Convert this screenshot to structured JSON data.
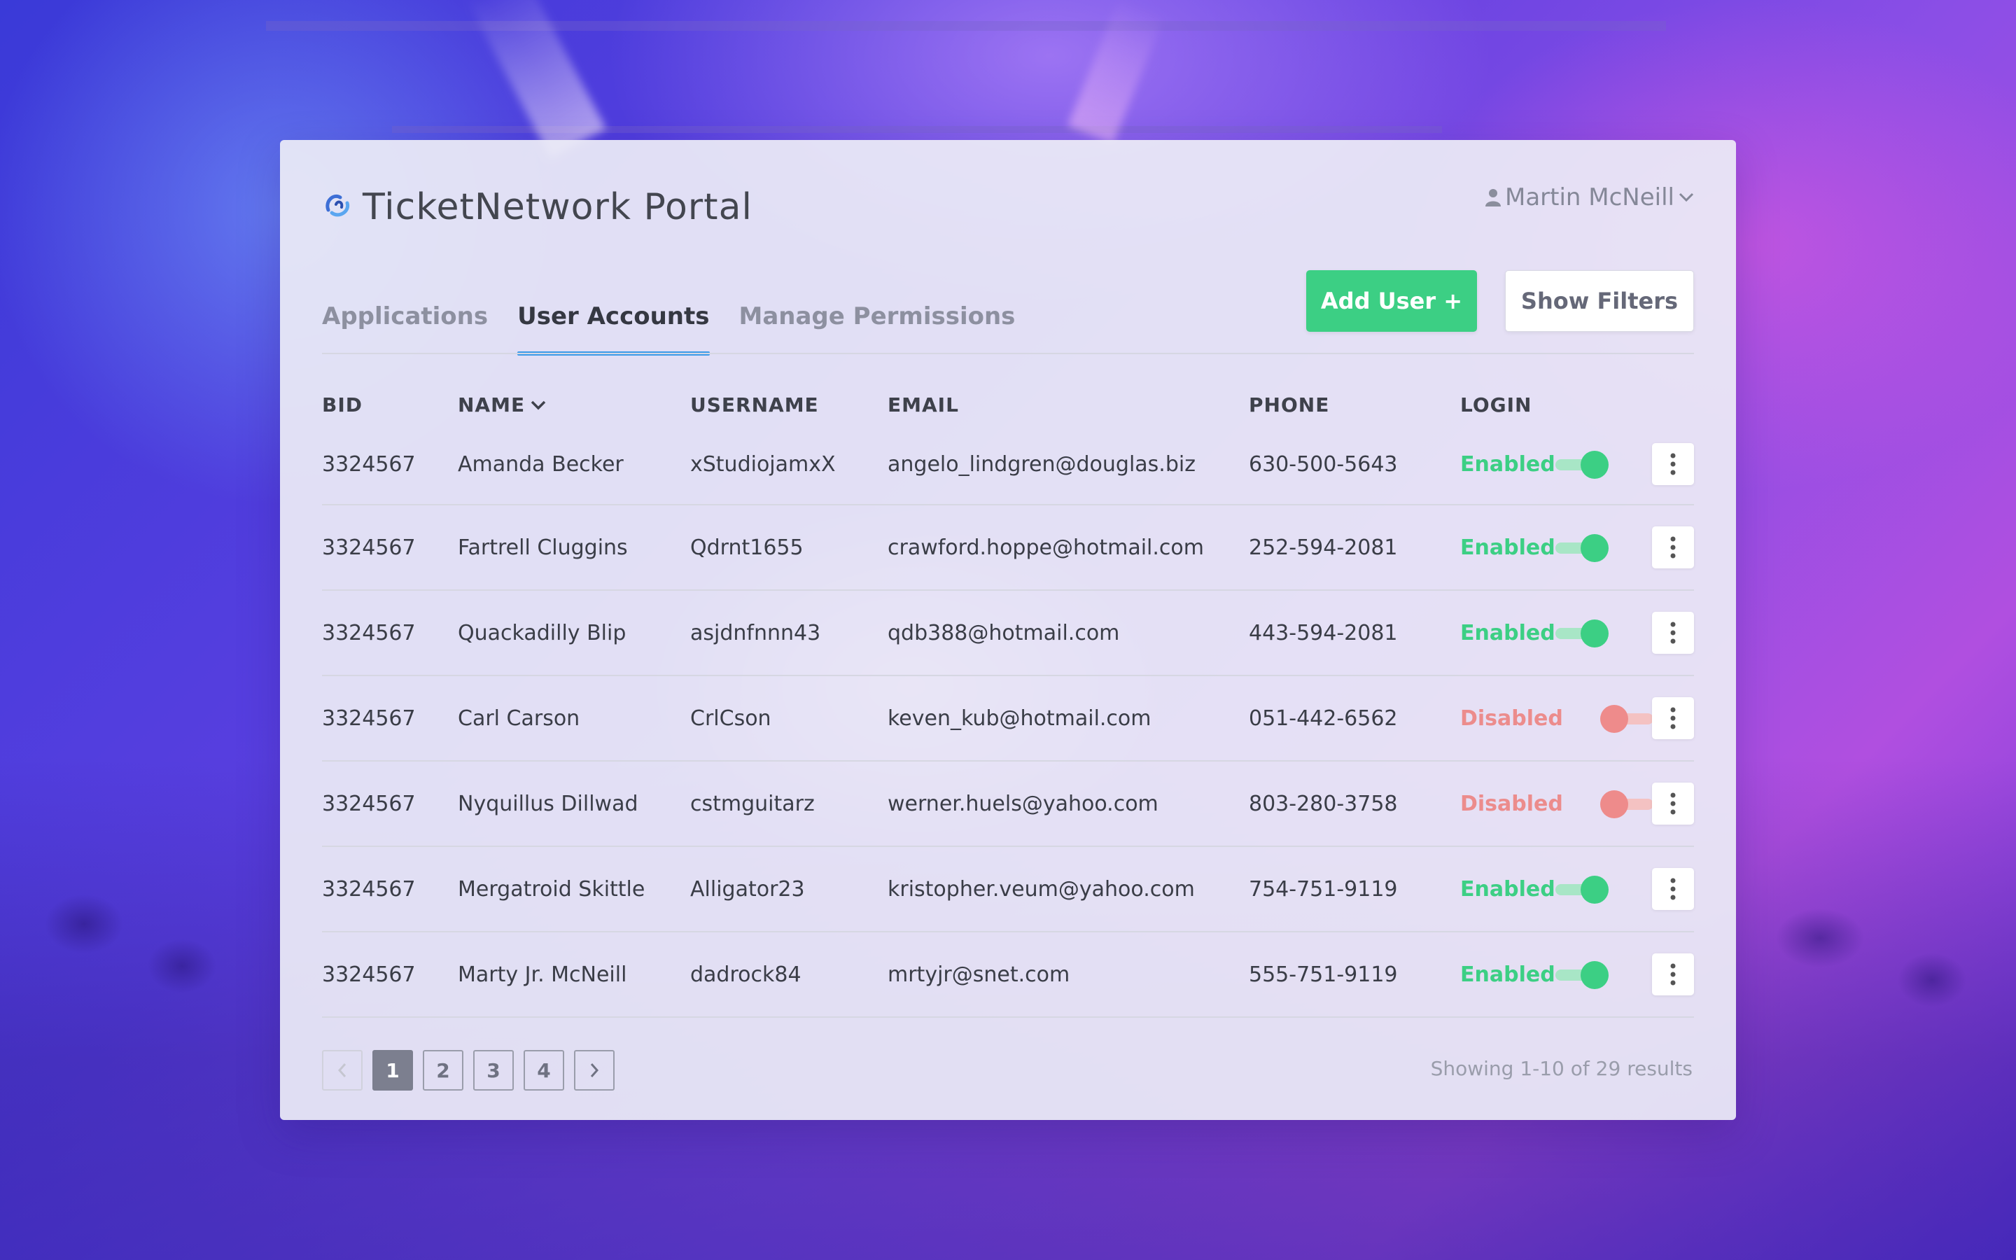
{
  "app": {
    "title": "TicketNetwork Portal"
  },
  "user_menu": {
    "name": "Martin McNeill"
  },
  "tabs": [
    {
      "label": "Applications",
      "active": false
    },
    {
      "label": "User Accounts",
      "active": true
    },
    {
      "label": "Manage Permissions",
      "active": false
    }
  ],
  "actions": {
    "add_user": "Add User +",
    "show_filters": "Show Filters"
  },
  "table": {
    "columns": {
      "bid": "BID",
      "name": "NAME",
      "username": "USERNAME",
      "email": "EMAIL",
      "phone": "PHONE",
      "login": "LOGIN"
    },
    "sorted_by": "name",
    "rows": [
      {
        "bid": "3324567",
        "name": "Amanda Becker",
        "username": "xStudiojamxX",
        "email": "angelo_lindgren@douglas.biz",
        "phone": "630-500-5643",
        "login": "Enabled",
        "enabled": true
      },
      {
        "bid": "3324567",
        "name": "Fartrell Cluggins",
        "username": "Qdrnt1655",
        "email": "crawford.hoppe@hotmail.com",
        "phone": "252-594-2081",
        "login": "Enabled",
        "enabled": true
      },
      {
        "bid": "3324567",
        "name": "Quackadilly Blip",
        "username": "asjdnfnnn43",
        "email": "qdb388@hotmail.com",
        "phone": "443-594-2081",
        "login": "Enabled",
        "enabled": true
      },
      {
        "bid": "3324567",
        "name": "Carl Carson",
        "username": "CrlCson",
        "email": "keven_kub@hotmail.com",
        "phone": "051-442-6562",
        "login": "Disabled",
        "enabled": false
      },
      {
        "bid": "3324567",
        "name": "Nyquillus Dillwad",
        "username": "cstmguitarz",
        "email": "werner.huels@yahoo.com",
        "phone": "803-280-3758",
        "login": "Disabled",
        "enabled": false
      },
      {
        "bid": "3324567",
        "name": "Mergatroid Skittle",
        "username": "Alligator23",
        "email": "kristopher.veum@yahoo.com",
        "phone": "754-751-9119",
        "login": "Enabled",
        "enabled": true
      },
      {
        "bid": "3324567",
        "name": "Marty Jr. McNeill",
        "username": "dadrock84",
        "email": "mrtyjr@snet.com",
        "phone": "555-751-9119",
        "login": "Enabled",
        "enabled": true
      }
    ]
  },
  "pagination": {
    "pages": [
      "1",
      "2",
      "3",
      "4"
    ],
    "current": "1",
    "prev_disabled": true,
    "summary": "Showing 1-10 of 29 results"
  },
  "colors": {
    "accent_green": "#3ccf84",
    "accent_red": "#ec8c8c",
    "tab_underline": "#3d9be9"
  },
  "icons": {
    "logo": "ticketnetwork-logo-icon",
    "user": "person-icon",
    "caret": "chevron-down-icon",
    "more": "vertical-dots-icon",
    "prev": "chevron-left-icon",
    "next": "chevron-right-icon"
  }
}
